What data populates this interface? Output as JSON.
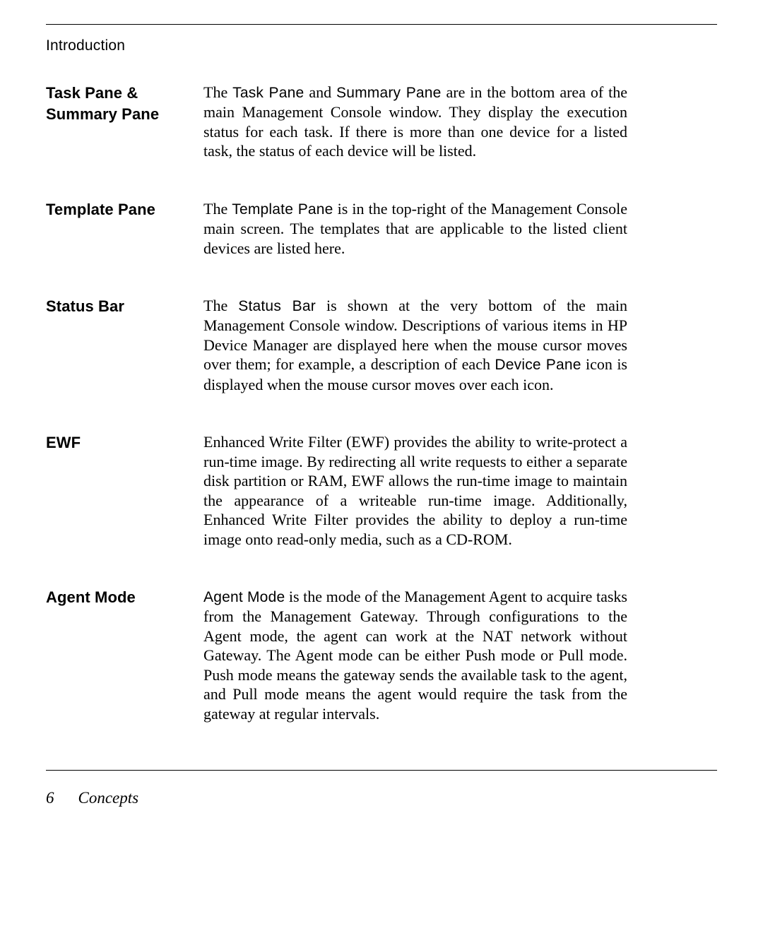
{
  "header": {
    "label": "Introduction"
  },
  "definitions": [
    {
      "term": "Task Pane & Summary Pane",
      "body_pre": "The ",
      "sf1": "Task Pane",
      "mid1": " and ",
      "sf2": "Summary Pane",
      "body_post": " are in the bottom area of the main Management Console window. They display the execution status for each task. If there is more than one device for a listed task, the status of each device will be listed."
    },
    {
      "term": "Template Pane",
      "body_pre": "The ",
      "sf1": "Template Pane",
      "body_post": " is in the top-right of the Management Console main screen. The templates that are applicable to the listed client devices are listed here."
    },
    {
      "term": "Status Bar",
      "body_pre": "The ",
      "sf1": "Status Bar",
      "mid1": " is shown at the very bottom of the main Management Console window. Descriptions of various items in HP Device Manager are displayed here when the mouse cursor moves over them; for example, a description of each ",
      "sf2": "Device Pane",
      "body_post": " icon is displayed when the mouse cursor moves over each icon."
    },
    {
      "term": "EWF",
      "body_pre": "",
      "body_post": "Enhanced Write Filter (EWF) provides the ability to write-protect a run-time image. By redirecting all write requests to either a separate disk partition or RAM, EWF allows the run-time image to maintain the appearance of a writeable run-time image. Additionally, Enhanced Write Filter provides the ability to deploy a run-time image onto read-only media, such as a CD-ROM."
    },
    {
      "term": "Agent Mode",
      "sf1": "Agent Mode",
      "body_post": " is the mode of the Management Agent to acquire tasks from the Management Gateway. Through configurations to the Agent mode, the agent can work at the NAT network without Gateway. The Agent mode can be either Push mode or Pull mode. Push mode means the gateway sends the available task to the agent, and Pull mode means the agent would require the task from the gateway at regular intervals."
    }
  ],
  "footer": {
    "page_number": "6",
    "section": "Concepts"
  }
}
